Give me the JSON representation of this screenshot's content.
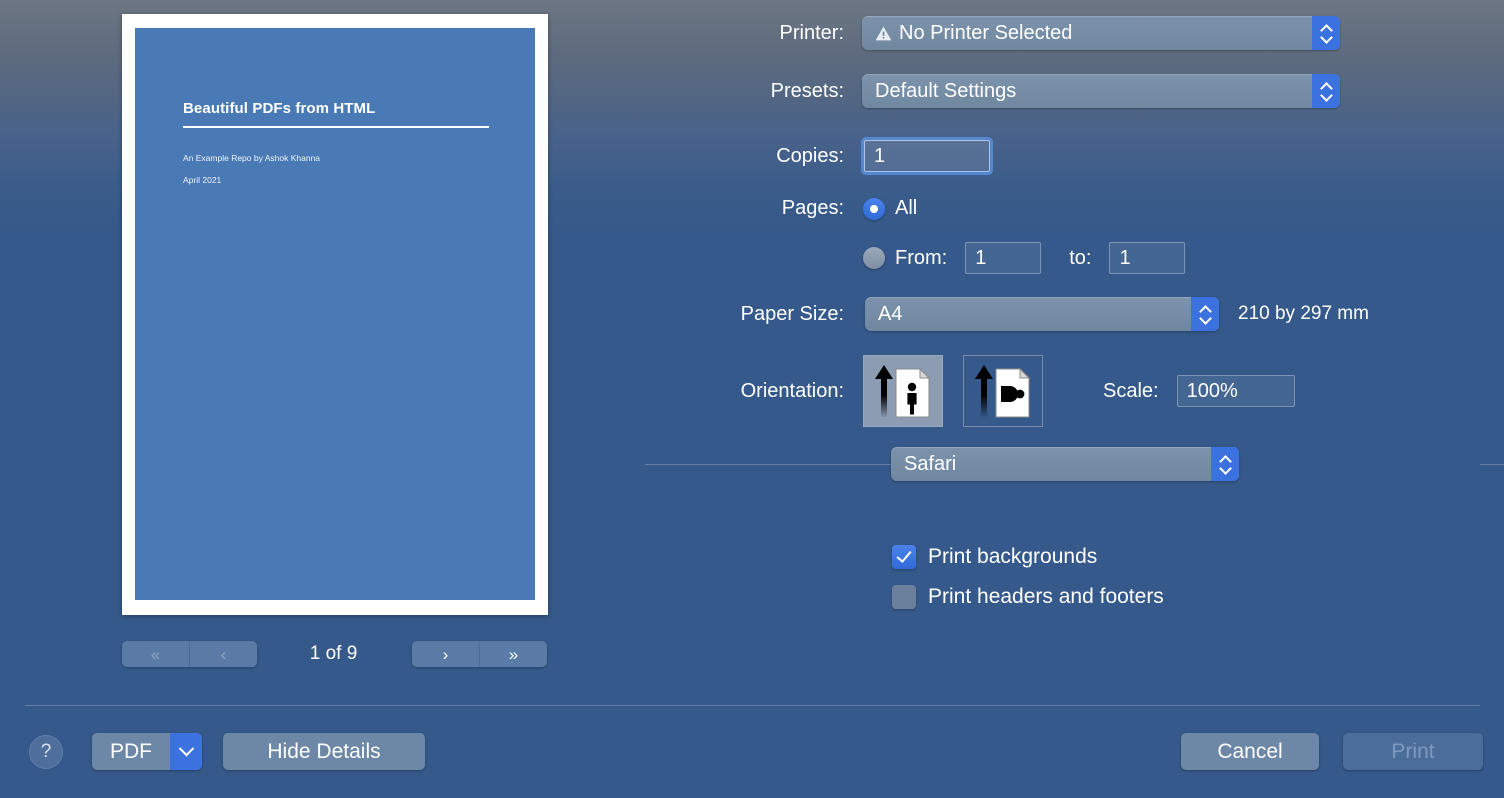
{
  "preview": {
    "doc_title": "Beautiful PDFs from HTML",
    "doc_author": "An Example Repo by Ashok Khanna",
    "doc_date": "April 2021",
    "pager": {
      "first_label": "«",
      "prev_label": "‹",
      "next_label": "›",
      "last_label": "»",
      "count_label": "1 of 9"
    }
  },
  "settings": {
    "printer": {
      "label": "Printer:",
      "value": "No Printer Selected",
      "icon": "warning-triangle-icon"
    },
    "presets": {
      "label": "Presets:",
      "value": "Default Settings"
    },
    "copies": {
      "label": "Copies:",
      "value": "1"
    },
    "pages": {
      "label": "Pages:",
      "all_label": "All",
      "all_selected": true,
      "from_label": "From:",
      "from_value": "1",
      "to_label": "to:",
      "to_value": "1"
    },
    "paper_size": {
      "label": "Paper Size:",
      "value": "A4",
      "dimensions": "210 by 297 mm"
    },
    "orientation": {
      "label": "Orientation:",
      "portrait_selected": true,
      "portrait_icon": "portrait-orientation-icon",
      "landscape_icon": "landscape-orientation-icon"
    },
    "scale": {
      "label": "Scale:",
      "value": "100%"
    },
    "app_section": {
      "value": "Safari"
    },
    "checkboxes": [
      {
        "label": "Print backgrounds",
        "checked": true
      },
      {
        "label": "Print headers and footers",
        "checked": false
      }
    ]
  },
  "bottom_bar": {
    "help_label": "?",
    "pdf_label": "PDF",
    "hide_details_label": "Hide Details",
    "cancel_label": "Cancel",
    "print_label": "Print",
    "print_enabled": false
  },
  "colors": {
    "accent_blue": "#3c72e0",
    "page_blue": "#4a7ab5",
    "background_blue": "#35598a"
  }
}
